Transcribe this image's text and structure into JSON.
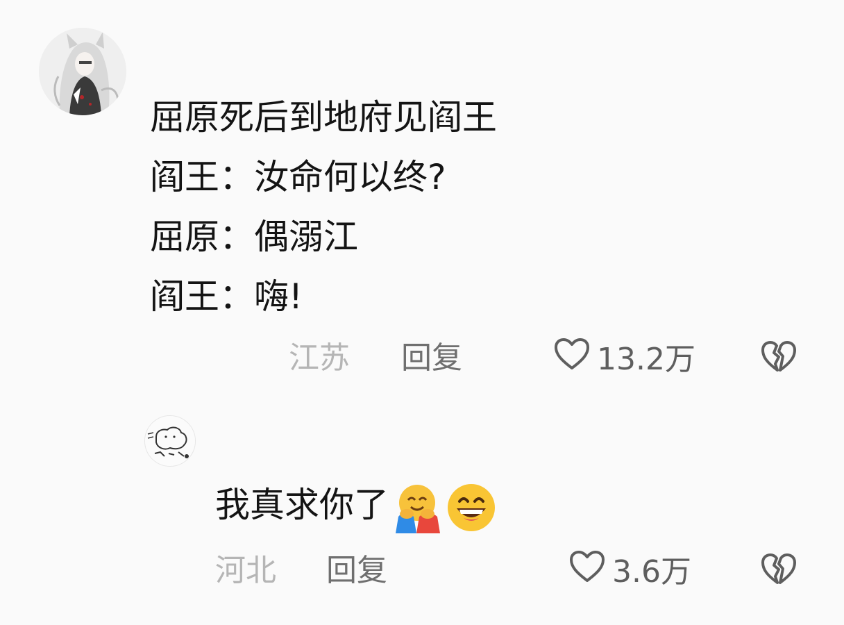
{
  "comments": [
    {
      "avatar_icon": "anime-character-avatar",
      "lines": [
        "屈原死后到地府见阎王",
        "阎王：汝命何以终?",
        "屈原：偶溺江",
        "阎王：嗨!"
      ],
      "location": "江苏",
      "reply_label": "回复",
      "likes": "13.2万",
      "like_icon": "heart-outline-icon",
      "dislike_icon": "broken-heart-icon"
    },
    {
      "avatar_icon": "sketch-animal-avatar",
      "text": "我真求你了",
      "emojis": [
        "hugging-face-emoji",
        "grinning-face-emoji"
      ],
      "location": "河北",
      "reply_label": "回复",
      "likes": "3.6万",
      "like_icon": "heart-outline-icon",
      "dislike_icon": "broken-heart-icon"
    }
  ]
}
